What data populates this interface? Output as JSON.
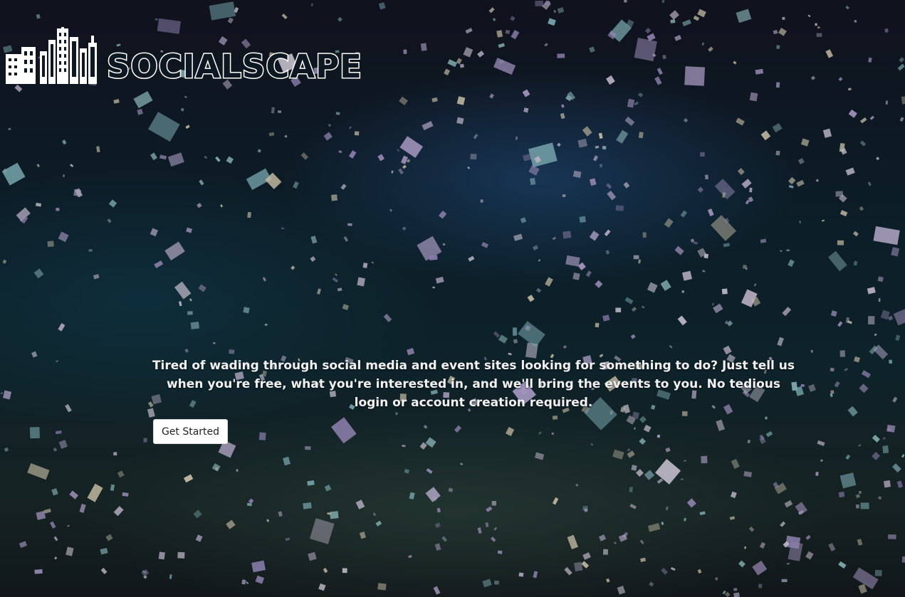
{
  "brand": {
    "name": "SOCIALSCAPE",
    "logo_icon": "city-skyline-icon"
  },
  "hero": {
    "tagline": "Tired of wading through social media and event sites looking for something to do? Just tell us when you're free, what you're interested in, and we'll bring the events to you. No tedious login or account creation required.",
    "cta_label": "Get Started"
  },
  "colors": {
    "text": "#f2f2f2",
    "button_bg": "#ffffff",
    "button_text": "#222222",
    "logo_stroke": "#ffffff",
    "background_dark": "#0f2430"
  }
}
